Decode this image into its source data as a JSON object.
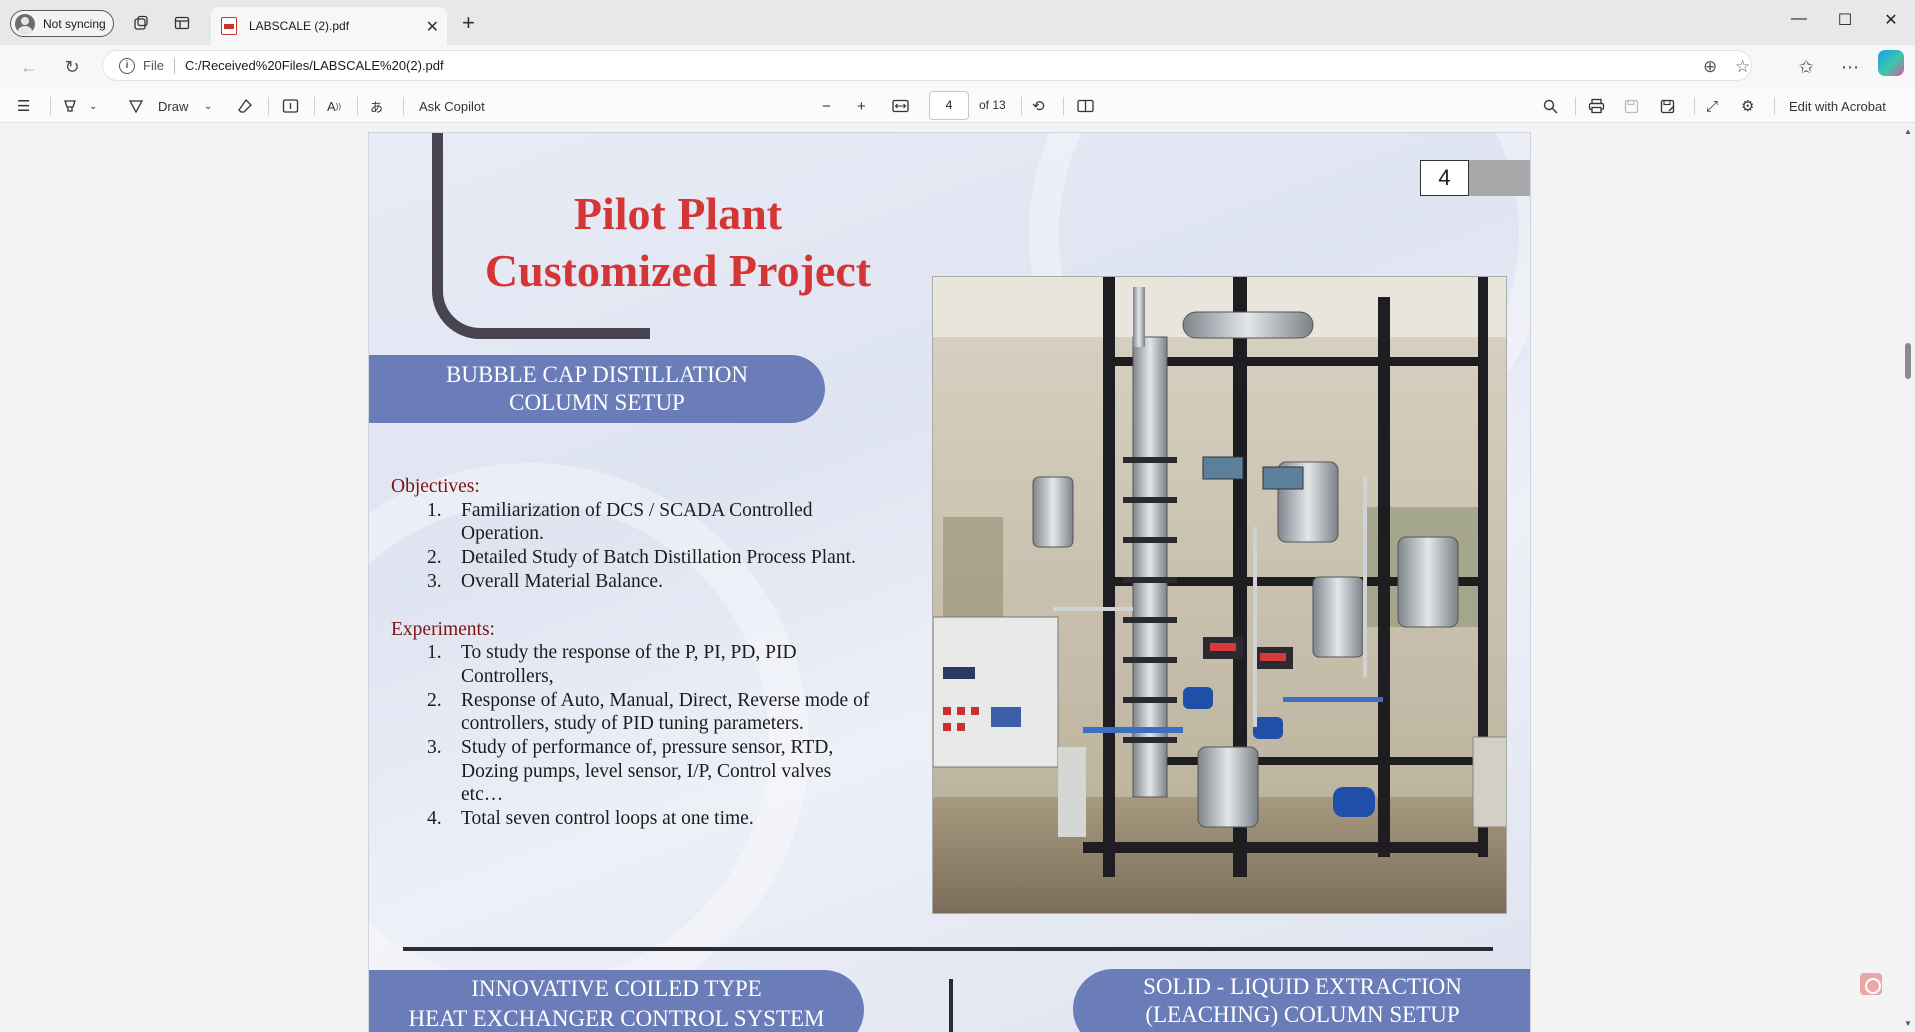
{
  "browser": {
    "profile_label": "Not syncing",
    "tab_title": "LABSCALE (2).pdf",
    "address": {
      "scheme": "File",
      "url": "C:/Received%20Files/LABSCALE%20(2).pdf"
    }
  },
  "pdf_toolbar": {
    "draw_label": "Draw",
    "ask_copilot_label": "Ask Copilot",
    "page_current": "4",
    "page_total_label": "of 13",
    "edit_acrobat_label": "Edit with Acrobat"
  },
  "pdf_page": {
    "page_number": "4",
    "title_line1": "Pilot Plant",
    "title_line2": "Customized Project",
    "section_title_line1": "BUBBLE CAP DISTILLATION",
    "section_title_line2": "COLUMN SETUP",
    "objectives_heading": "Objectives:",
    "objectives": [
      {
        "num": "1.",
        "text": "Familiarization of DCS / SCADA Controlled Operation."
      },
      {
        "num": "2.",
        "text": "Detailed Study of Batch Distillation Process Plant."
      },
      {
        "num": "3.",
        "text": "Overall Material Balance."
      }
    ],
    "experiments_heading": "Experiments:",
    "experiments": [
      {
        "num": "1.",
        "text": "To study the response of the P, PI, PD, PID Controllers,"
      },
      {
        "num": "2.",
        "text": "Response of Auto, Manual, Direct, Reverse mode of controllers, study of PID tuning parameters."
      },
      {
        "num": "3.",
        "text": "Study of performance of, pressure sensor, RTD, Dozing pumps, level sensor, I/P, Control valves etc…"
      },
      {
        "num": "4.",
        "text": "Total seven control loops at one time."
      }
    ],
    "bottom_left_line1": "INNOVATIVE COILED TYPE",
    "bottom_left_line2": "HEAT EXCHANGER CONTROL SYSTEM",
    "bottom_right_line1": "SOLID - LIQUID EXTRACTION",
    "bottom_right_line2": "(LEACHING) COLUMN SETUP"
  },
  "colors": {
    "title_red": "#d43535",
    "pill_blue": "#6b7db9",
    "heading_maroon": "#7a1515"
  }
}
